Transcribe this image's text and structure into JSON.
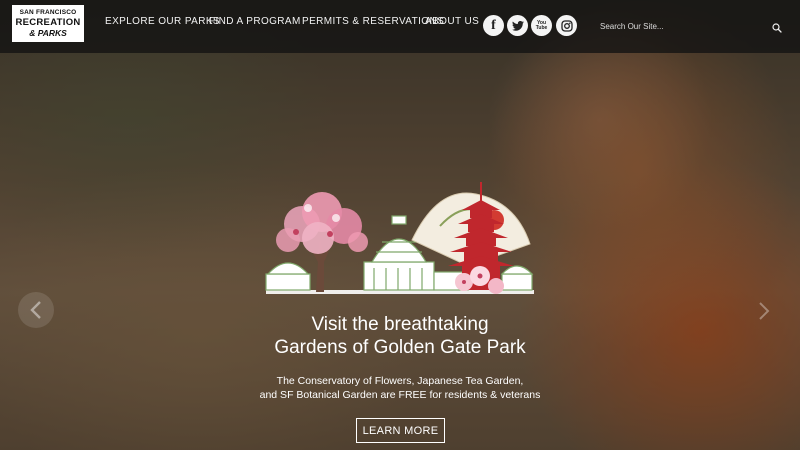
{
  "logo": {
    "line1": "SAN FRANCISCO",
    "line2": "RECREATION",
    "line3": "& PARKS"
  },
  "nav": {
    "items": [
      {
        "label": "EXPLORE OUR PARKS"
      },
      {
        "label": "FIND A PROGRAM"
      },
      {
        "label": "PERMITS & RESERVATIONS"
      },
      {
        "label": "ABOUT US"
      }
    ]
  },
  "social": [
    {
      "icon": "facebook-icon",
      "glyph": "f"
    },
    {
      "icon": "twitter-icon",
      "glyph": ""
    },
    {
      "icon": "youtube-icon",
      "glyph": "You Tube"
    },
    {
      "icon": "instagram-icon",
      "glyph": ""
    }
  ],
  "search": {
    "placeholder": "Search Our Site...",
    "value": ""
  },
  "hero": {
    "headline_line1": "Visit the breathtaking",
    "headline_line2": "Gardens of Golden Gate Park",
    "sub_line1": "The Conservatory of Flowers, Japanese Tea Garden,",
    "sub_line2": "and SF Botanical Garden are FREE for residents & veterans",
    "cta_label": "LEARN MORE"
  },
  "colors": {
    "header_bg": "#121212",
    "text": "#ffffff",
    "blossom": "#e8a0b4",
    "pagoda": "#c0272d",
    "conservatory": "#7fa86a"
  }
}
